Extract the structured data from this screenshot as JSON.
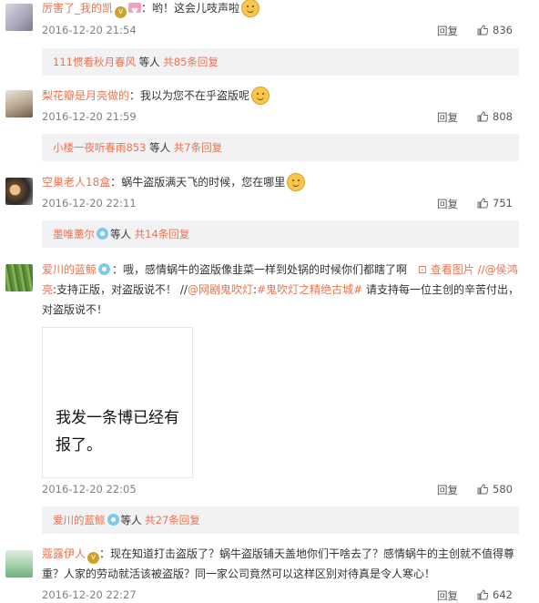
{
  "comments": [
    {
      "name": "厉害了_我的凯",
      "sep": "：",
      "text": "哟！这会儿吱声啦",
      "time": "2016-12-20 21:54",
      "reply_label": "回复",
      "likes": "836",
      "sub": {
        "user": "111惯看秋月春风",
        "mid": " 等人 ",
        "count": "共85条回复"
      }
    },
    {
      "name": "梨花瓣是月亮做的",
      "sep": "：",
      "text": "我以为您不在乎盗版呢",
      "time": "2016-12-20 21:59",
      "reply_label": "回复",
      "likes": "808",
      "sub": {
        "user": "小楼一夜听春雨853",
        "mid": " 等人 ",
        "count": "共7条回复"
      }
    },
    {
      "name": "空巢老人18盒",
      "sep": "：",
      "text": "蜗牛盗版满天飞的时候，您在哪里",
      "time": "2016-12-20 22:11",
      "reply_label": "回复",
      "likes": "751",
      "sub": {
        "user": "墨唯薰尔",
        "mid": "等人 ",
        "count": "共14条回复"
      }
    },
    {
      "name": "爱川的蓝鲸",
      "sep": "：",
      "text_a": "哦，感情蜗牛的盗版像韭菜一样到处锅的时候你们都瞎了啊",
      "view_pic": "查看图片",
      "mention1": "//@侯鸿亮",
      "text_b": ":支持正版，对盗版说不！",
      "text_c": "//",
      "mention2": "@网剧鬼吹灯",
      "text_d": ":",
      "topic": "#鬼吹灯之精绝古城#",
      "text_e": " 请支持每一位主创的辛苦付出，对盗版说不！",
      "image_line1": "我发一条博已经有",
      "image_line2": "报了。",
      "time": "2016-12-20 22:05",
      "reply_label": "回复",
      "likes": "580",
      "sub": {
        "user": "爱川的蓝鲸",
        "mid": "等人 ",
        "count": "共27条回复"
      }
    },
    {
      "name": "蔻露伊人",
      "sep": "：",
      "text": "现在知道打击盗版了？蜗牛盗版铺天盖地你们干啥去了？感情蜗牛的主创就不值得尊重？人家的劳动就活该被盗版？同一家公司竟然可以这样区别对待真是令人寒心！",
      "time": "2016-12-20 22:27",
      "reply_label": "回复",
      "likes": "642"
    }
  ],
  "colors": {
    "accent": "#eb7350",
    "subbg": "#f2f2f5",
    "muted": "#808080"
  }
}
